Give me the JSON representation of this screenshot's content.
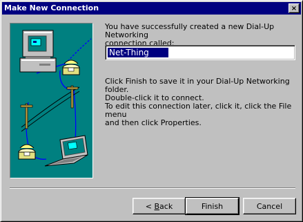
{
  "window": {
    "title": "Make New Connection",
    "close_label": "×"
  },
  "content": {
    "intro": "You have successfully created a new Dial-Up Networking\nconnection called:",
    "connection_name": "Net-Thing",
    "finish_hint": "Click Finish to save it in your Dial-Up Networking folder.\nDouble-click it to connect.",
    "edit_hint": "To edit this connection later, click it, click the File menu\nand then click Properties."
  },
  "buttons": {
    "back_prefix": "< ",
    "back_accel": "B",
    "back_rest": "ack",
    "finish": "Finish",
    "cancel": "Cancel"
  },
  "illustration": {
    "icons": [
      "desktop-computer-icon",
      "telephone-icon",
      "telephone-pole-icon",
      "laptop-icon"
    ],
    "background_color": "#008080"
  },
  "colors": {
    "titlebar": "#000080",
    "face": "#c0c0c0",
    "selection": "#000080"
  }
}
